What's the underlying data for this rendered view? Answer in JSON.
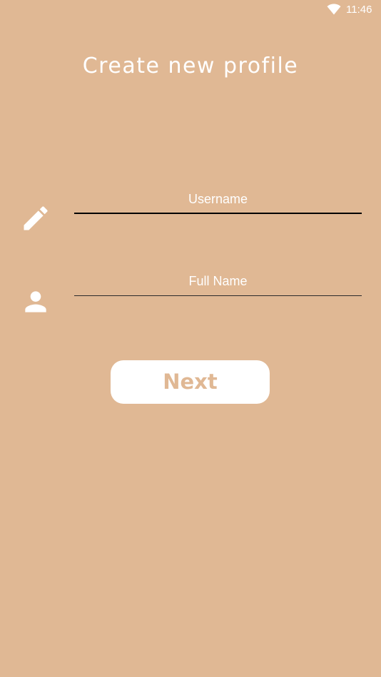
{
  "status_bar": {
    "time": "11:46",
    "icons": [
      "wifi-icon"
    ]
  },
  "header": {
    "title": "Create new profile"
  },
  "form": {
    "username": {
      "icon": "pencil-icon",
      "placeholder": "Username",
      "value": ""
    },
    "full_name": {
      "icon": "person-icon",
      "placeholder": "Full Name",
      "value": ""
    }
  },
  "actions": {
    "next_label": "Next"
  },
  "colors": {
    "background": "#E0B894",
    "button_bg": "#FFFFFF",
    "button_text": "#E0B894",
    "text": "#FFFFFF",
    "underline": "#000000"
  }
}
